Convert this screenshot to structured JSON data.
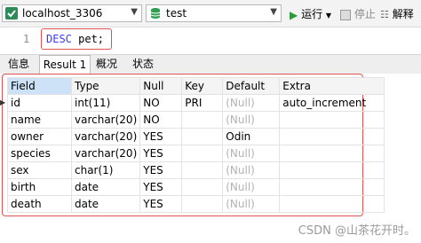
{
  "toolbar": {
    "connection": "localhost_3306",
    "database": "test",
    "run_label": "运行",
    "stop_label": "停止",
    "explain_label": "解释"
  },
  "editor": {
    "line_number": "1",
    "keyword": "DESC",
    "rest": " pet;"
  },
  "tabs": [
    {
      "label": "信息"
    },
    {
      "label": "Result 1"
    },
    {
      "label": "概况"
    },
    {
      "label": "状态"
    }
  ],
  "grid": {
    "columns": [
      "Field",
      "Type",
      "Null",
      "Key",
      "Default",
      "Extra"
    ],
    "rows": [
      [
        "id",
        "int(11)",
        "NO",
        "PRI",
        "(Null)",
        "auto_increment"
      ],
      [
        "name",
        "varchar(20)",
        "NO",
        "",
        "(Null)",
        ""
      ],
      [
        "owner",
        "varchar(20)",
        "YES",
        "",
        "Odin",
        ""
      ],
      [
        "species",
        "varchar(20)",
        "YES",
        "",
        "(Null)",
        ""
      ],
      [
        "sex",
        "char(1)",
        "YES",
        "",
        "(Null)",
        ""
      ],
      [
        "birth",
        "date",
        "YES",
        "",
        "(Null)",
        ""
      ],
      [
        "death",
        "date",
        "YES",
        "",
        "(Null)",
        ""
      ]
    ]
  },
  "watermark": "CSDN @山茶花开时。"
}
